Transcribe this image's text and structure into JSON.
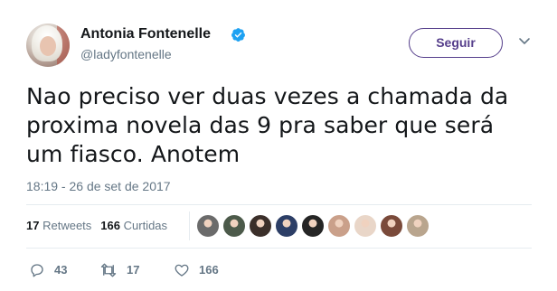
{
  "author": {
    "display_name": "Antonia Fontenelle",
    "screen_name": "@ladyfontenelle",
    "verified_icon": "verified-badge-icon",
    "avatar_icon": "profile-photo"
  },
  "follow_button": {
    "label": "Seguir",
    "color": "#553e8b"
  },
  "caret_icon": "chevron-down-icon",
  "tweet": {
    "text": "Nao preciso ver duas vezes a chamada da proxima novela das 9 pra saber que será um fiasco. Anotem",
    "timestamp": "18:19 - 26 de set de 2017"
  },
  "stats": {
    "retweets_count": "17",
    "retweets_label": "Retweets",
    "likes_count": "166",
    "likes_label": "Curtidas"
  },
  "likers": [
    {
      "color": "#6b6b6b"
    },
    {
      "color": "#4c5a4a"
    },
    {
      "color": "#3b2f2a"
    },
    {
      "color": "#2c3e66"
    },
    {
      "color": "#252525"
    },
    {
      "color": "#caa08a"
    },
    {
      "color": "#e9d6c8"
    },
    {
      "color": "#7a4a3a"
    },
    {
      "color": "#b9a58e"
    }
  ],
  "actions": {
    "reply_count": "43",
    "retweet_count": "17",
    "like_count": "166",
    "reply_icon": "reply-icon",
    "retweet_icon": "retweet-icon",
    "like_icon": "heart-icon"
  },
  "colors": {
    "text": "#14171a",
    "secondary": "#657786",
    "verified": "#1da1f2",
    "divider": "#e6ecf0"
  }
}
